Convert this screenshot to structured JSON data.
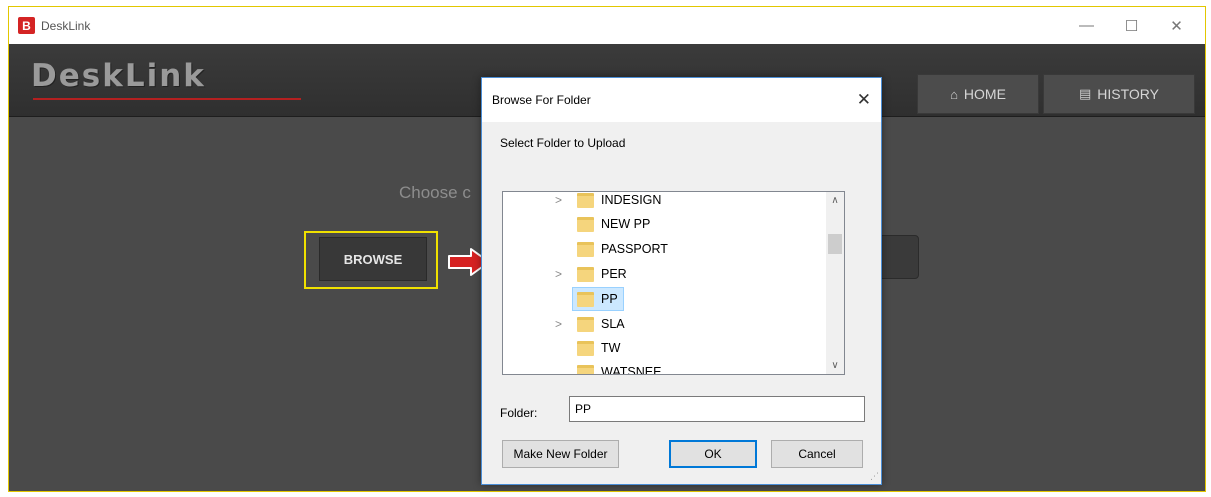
{
  "window": {
    "app_icon": "B",
    "title": "DeskLink",
    "minimize": "—",
    "maximize": "☐",
    "close": "✕"
  },
  "header": {
    "logo": "DeskLink",
    "nav": [
      {
        "icon": "home-icon",
        "glyph": "⌂",
        "label": "HOME"
      },
      {
        "icon": "history-icon",
        "glyph": "▤",
        "label": "HISTORY"
      }
    ]
  },
  "main": {
    "choose_text": "Choose c",
    "browse_label": "BROWSE",
    "arrow_color": "#d62222",
    "highlight_color": "#f0e100"
  },
  "dialog": {
    "title": "Browse For Folder",
    "close": "✕",
    "description": "Select Folder to Upload",
    "tree": [
      {
        "label": "INDESIGN",
        "expandable": true,
        "selected": false
      },
      {
        "label": "NEW PP",
        "expandable": false,
        "selected": false
      },
      {
        "label": "PASSPORT",
        "expandable": false,
        "selected": false
      },
      {
        "label": "PER",
        "expandable": true,
        "selected": false
      },
      {
        "label": "PP",
        "expandable": false,
        "selected": true
      },
      {
        "label": "SLA",
        "expandable": true,
        "selected": false
      },
      {
        "label": "TW",
        "expandable": false,
        "selected": false
      },
      {
        "label": "WATSNEE",
        "expandable": false,
        "selected": false
      }
    ],
    "expand_glyph": ">",
    "scroll_up": "∧",
    "scroll_down": "∨",
    "folder_label": "Folder:",
    "folder_value": "PP",
    "buttons": {
      "make_new_folder": "Make New Folder",
      "ok": "OK",
      "cancel": "Cancel"
    }
  }
}
